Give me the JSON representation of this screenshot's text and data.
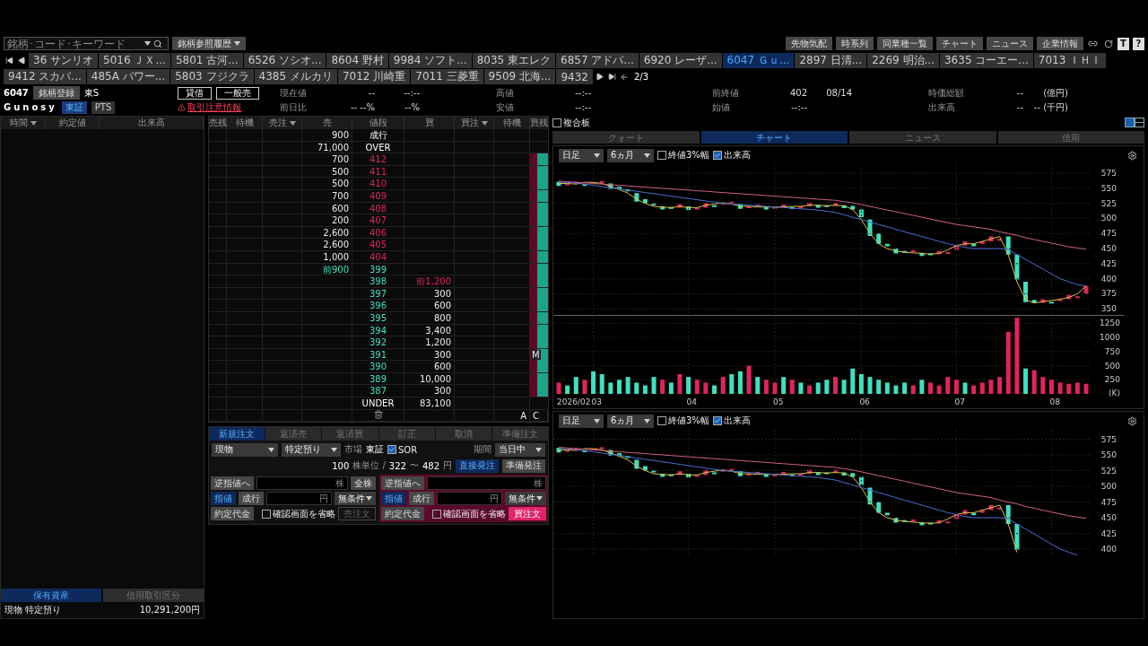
{
  "toolbar": {
    "search": {
      "placeholder": "銘柄･コード･キーワード"
    },
    "history_button": "銘柄参照履歴",
    "buttons": [
      "先物気配",
      "時系列",
      "同業種一覧",
      "チャート",
      "ニュース",
      "企業情報"
    ],
    "text_buttons": [
      "T",
      "?"
    ]
  },
  "ticker_tabs": [
    {
      "label": "36 サンリオ",
      "selected": false
    },
    {
      "label": "5016 ＪＸ...",
      "selected": false
    },
    {
      "label": "5801 古河...",
      "selected": false
    },
    {
      "label": "6526 ソシオ...",
      "selected": false
    },
    {
      "label": "8604 野村",
      "selected": false
    },
    {
      "label": "9984 ソフト...",
      "selected": false
    },
    {
      "label": "8035 東エレク",
      "selected": false
    },
    {
      "label": "6857 アドバ...",
      "selected": false
    },
    {
      "label": "6920 レーザ...",
      "selected": false
    },
    {
      "label": "6047 Ｇｕ...",
      "selected": true
    },
    {
      "label": "2897 日清...",
      "selected": false
    },
    {
      "label": "2269 明治...",
      "selected": false
    },
    {
      "label": "3635 コーエー...",
      "selected": false
    },
    {
      "label": "7013 ＩＨＩ",
      "selected": false
    },
    {
      "label": "9412 スカパ...",
      "selected": false
    },
    {
      "label": "485A パワー...",
      "selected": false
    },
    {
      "label": "5803 フジクラ",
      "selected": false
    },
    {
      "label": "4385 メルカリ",
      "selected": false
    },
    {
      "label": "7012 川崎重",
      "selected": false
    },
    {
      "label": "7011 三菱重",
      "selected": false
    },
    {
      "label": "9509 北海...",
      "selected": false
    },
    {
      "label": "9432",
      "selected": false
    }
  ],
  "pager": "2/3",
  "stock": {
    "code": "6047",
    "register_button": "銘柄登録",
    "market_short": "東S",
    "name": "Gunosy",
    "venues": [
      {
        "label": "東証",
        "selected": true
      },
      {
        "label": "PTS",
        "selected": false
      }
    ],
    "badges": [
      "貸借",
      "一般売"
    ],
    "warning": "取引注意情報",
    "quotes": [
      {
        "label": "現在値",
        "values": [
          "--",
          "--:--"
        ]
      },
      {
        "label": "高値",
        "values": [
          "--:--"
        ]
      },
      {
        "label": "前終値",
        "values": [
          "402",
          "08/14"
        ]
      },
      {
        "label": "時価総額",
        "values": [
          "--",
          "(億円)"
        ]
      },
      {
        "label": "前日比",
        "values": [
          "-- --%",
          "--%"
        ]
      },
      {
        "label": "安値",
        "values": [
          "--:--"
        ]
      },
      {
        "label": "始値",
        "values": [
          "--:--"
        ]
      },
      {
        "label": "出来高",
        "values": [
          "--",
          "-- (千円)"
        ]
      }
    ]
  },
  "executions_panel": {
    "columns": [
      "時間",
      "約定値",
      "出来高"
    ],
    "tabs": [
      {
        "label": "保有資産",
        "selected": true
      },
      {
        "label": "信用取引区分",
        "selected": false
      }
    ],
    "holdings": [
      {
        "label": "現物 特定預り",
        "value": "10,291,200円"
      }
    ]
  },
  "order_book": {
    "columns": [
      {
        "label": "売残",
        "menu": false
      },
      {
        "label": "待機",
        "menu": false
      },
      {
        "label": "売注",
        "menu": true
      },
      {
        "label": "売",
        "menu": false
      },
      {
        "label": "値段",
        "menu": false
      },
      {
        "label": "買",
        "menu": false
      },
      {
        "label": "買注",
        "menu": true
      },
      {
        "label": "待機",
        "menu": false
      },
      {
        "label": "買残",
        "menu": false
      }
    ],
    "rows": [
      {
        "sell": "900",
        "price": "成行",
        "buy": "",
        "kind": "plain",
        "previous": false
      },
      {
        "sell": "71,000",
        "price": "OVER",
        "buy": "",
        "kind": "plain",
        "previous": false
      },
      {
        "sell": "700",
        "price": "412",
        "buy": "",
        "kind": "ask",
        "previous": false
      },
      {
        "sell": "500",
        "price": "411",
        "buy": "",
        "kind": "ask",
        "previous": false
      },
      {
        "sell": "500",
        "price": "410",
        "buy": "",
        "kind": "ask",
        "previous": false
      },
      {
        "sell": "700",
        "price": "409",
        "buy": "",
        "kind": "ask",
        "previous": false
      },
      {
        "sell": "600",
        "price": "408",
        "buy": "",
        "kind": "ask",
        "previous": false
      },
      {
        "sell": "200",
        "price": "407",
        "buy": "",
        "kind": "ask",
        "previous": false
      },
      {
        "sell": "2,600",
        "price": "406",
        "buy": "",
        "kind": "ask",
        "previous": false
      },
      {
        "sell": "2,600",
        "price": "405",
        "buy": "",
        "kind": "ask",
        "previous": false
      },
      {
        "sell": "1,000",
        "price": "404",
        "buy": "",
        "kind": "ask",
        "previous": false
      },
      {
        "sell": "前900",
        "price": "399",
        "buy": "",
        "kind": "bid",
        "previous": true
      },
      {
        "sell": "",
        "price": "398",
        "buy": "前1,200",
        "kind": "bid",
        "previous": true
      },
      {
        "sell": "",
        "price": "397",
        "buy": "300",
        "kind": "bid",
        "previous": false
      },
      {
        "sell": "",
        "price": "396",
        "buy": "600",
        "kind": "bid",
        "previous": false
      },
      {
        "sell": "",
        "price": "395",
        "buy": "800",
        "kind": "bid",
        "previous": false
      },
      {
        "sell": "",
        "price": "394",
        "buy": "3,400",
        "kind": "bid",
        "previous": false
      },
      {
        "sell": "",
        "price": "392",
        "buy": "1,200",
        "kind": "bid",
        "previous": false
      },
      {
        "sell": "",
        "price": "391",
        "buy": "300",
        "kind": "bid",
        "previous": false,
        "marker": "M"
      },
      {
        "sell": "",
        "price": "390",
        "buy": "600",
        "kind": "bid",
        "previous": false
      },
      {
        "sell": "",
        "price": "389",
        "buy": "10,000",
        "kind": "bid",
        "previous": false
      },
      {
        "sell": "",
        "price": "387",
        "buy": "300",
        "kind": "bid",
        "previous": false
      },
      {
        "sell": "",
        "price": "UNDER",
        "buy": "83,100",
        "kind": "plain",
        "previous": false
      }
    ],
    "footer": [
      "A",
      "C"
    ]
  },
  "order_entry": {
    "tabs": [
      {
        "label": "新規注文",
        "selected": true
      },
      {
        "label": "返済売",
        "selected": false
      },
      {
        "label": "返済買",
        "selected": false
      },
      {
        "label": "訂正",
        "selected": false
      },
      {
        "label": "取消",
        "selected": false
      },
      {
        "label": "準備注文",
        "selected": false
      }
    ],
    "account": "現物",
    "custody": "特定預り",
    "market_label": "市場",
    "market": "東証",
    "sor": {
      "label": "SOR",
      "checked": true
    },
    "term_label": "期間",
    "term": "当日中",
    "unit": "100",
    "unit_label": "株単位 /",
    "price_low": "322",
    "range_sep": "〜",
    "price_high": "482",
    "currency": "円",
    "send_modes": [
      {
        "label": "直接発注",
        "selected": true
      },
      {
        "label": "準備発注",
        "selected": false
      }
    ],
    "sides": [
      {
        "kind": "sell",
        "stop_button": "逆指値へ",
        "qty_unit": "株",
        "all_button": "全株",
        "price_types": [
          {
            "label": "指値",
            "selected": true
          },
          {
            "label": "成行",
            "selected": false
          }
        ],
        "price_unit": "円",
        "condition": "無条件",
        "amount_button": "約定代金",
        "skip_confirm": {
          "label": "確認画面を省略",
          "checked": false
        },
        "submit": {
          "label": "売注文",
          "disabled": true
        }
      },
      {
        "kind": "buy",
        "stop_button": "逆指値へ",
        "qty_unit": "株",
        "price_types": [
          {
            "label": "指値",
            "selected": true
          },
          {
            "label": "成行",
            "selected": false
          }
        ],
        "price_unit": "円",
        "condition": "無条件",
        "amount_button": "約定代金",
        "skip_confirm": {
          "label": "確認画面を省略",
          "checked": false
        },
        "submit": {
          "label": "買注文",
          "disabled": false
        }
      }
    ]
  },
  "chart_panel": {
    "composite": {
      "label": "複合板",
      "checked": false
    },
    "tabs": [
      {
        "label": "クォート",
        "selected": false
      },
      {
        "label": "チャート",
        "selected": true
      },
      {
        "label": "ニュース",
        "selected": false
      },
      {
        "label": "信用",
        "selected": false
      }
    ],
    "charts": [
      {
        "period": "日足",
        "range": "6ヵ月",
        "options": [
          {
            "label": "終値3%幅",
            "checked": false
          },
          {
            "label": "出来高",
            "checked": true
          }
        ],
        "chart_data": {
          "type": "line",
          "grid": true,
          "ylim": [
            340,
            590
          ],
          "yticks": [
            350,
            375,
            400,
            425,
            450,
            475,
            500,
            525,
            550,
            575
          ],
          "series": [
            {
              "color": "#d8c040",
              "values": [
                558,
                558,
                557,
                560,
                560,
                558,
                553,
                548,
                542,
                532,
                525,
                520,
                519,
                518,
                520,
                518,
                518,
                522,
                524,
                526,
                524,
                520,
                520,
                519,
                519,
                519,
                519,
                520,
                520,
                522,
                522,
                521,
                522,
                521,
                515,
                498,
                475,
                458,
                450,
                446,
                444,
                443,
                442,
                441,
                442,
                448,
                455,
                458,
                458,
                462,
                466,
                470,
                440,
                395,
                365,
                360,
                362,
                364,
                366,
                369,
                375,
                388
              ]
            },
            {
              "color": "#4a6fd0",
              "values": [
                560,
                560,
                558,
                557,
                555,
                553,
                551,
                549,
                547,
                545,
                543,
                541,
                539,
                537,
                535,
                533,
                531,
                529,
                527,
                525,
                524,
                523,
                522,
                521,
                520,
                519,
                518,
                517,
                516,
                515,
                514,
                512,
                510,
                506,
                502,
                498,
                494,
                490,
                486,
                482,
                478,
                474,
                470,
                466,
                462,
                458,
                455,
                452,
                450,
                450,
                450,
                450,
                448,
                440,
                432,
                424,
                416,
                408,
                400,
                395,
                390,
                388
              ]
            },
            {
              "color": "#d06080",
              "values": [
                562,
                561,
                560,
                559,
                558,
                557,
                556,
                555,
                554,
                553,
                552,
                551,
                550,
                549,
                548,
                547,
                546,
                545,
                544,
                543,
                542,
                541,
                540,
                539,
                538,
                537,
                536,
                535,
                534,
                533,
                532,
                531,
                530,
                528,
                526,
                523,
                520,
                517,
                514,
                511,
                508,
                505,
                502,
                499,
                496,
                493,
                490,
                488,
                486,
                484,
                482,
                478,
                475,
                472,
                468,
                465,
                462,
                459,
                456,
                453,
                451,
                449
              ]
            }
          ]
        },
        "volume": {
          "month_labels": [
            "2026/02",
            "03",
            "04",
            "05",
            "06",
            "07",
            "08"
          ],
          "chart_data": {
            "type": "bar",
            "grid": true,
            "ylabel": "(K)",
            "ylim": [
              0,
              1400
            ],
            "yticks": [
              250,
              500,
              750,
              1000,
              1250
            ],
            "series": [
              {
                "color": "#e0245e",
                "values": [
                  200,
                  null,
                  null,
                  250,
                  null,
                  null,
                  null,
                  null,
                  null,
                  null,
                  null,
                  null,
                  250,
                  null,
                  350,
                  null,
                  250,
                  200,
                  null,
                  300,
                  null,
                  null,
                  500,
                  null,
                  250,
                  200,
                  null,
                  250,
                  null,
                  150,
                  null,
                  null,
                  300,
                  null,
                  null,
                  null,
                  null,
                  null,
                  null,
                  null,
                  null,
                  150,
                  null,
                  200,
                  150,
                  300,
                  250,
                  null,
                  150,
                  200,
                  250,
                  300,
                  1100,
                  1350,
                  null,
                  420,
                  300,
                  250,
                  200,
                  180,
                  200,
                  180
                ]
              },
              {
                "color": "#3ee0c0",
                "values": [
                  null,
                  150,
                  300,
                  null,
                  400,
                  350,
                  200,
                  250,
                  300,
                  200,
                  150,
                  300,
                  null,
                  200,
                  null,
                  300,
                  null,
                  null,
                  150,
                  null,
                  350,
                  400,
                  null,
                  300,
                  null,
                  null,
                  300,
                  null,
                  200,
                  null,
                  200,
                  250,
                  null,
                  250,
                  450,
                  350,
                  300,
                  250,
                  200,
                  150,
                  200,
                  null,
                  250,
                  null,
                  null,
                  null,
                  null,
                  200,
                  null,
                  null,
                  null,
                  null,
                  null,
                  null,
                  450,
                  null,
                  null,
                  null,
                  null,
                  null,
                  null,
                  null
                ]
              }
            ]
          }
        }
      },
      {
        "period": "日足",
        "range": "6ヵ月",
        "options": [
          {
            "label": "終値3%幅",
            "checked": false
          },
          {
            "label": "出来高",
            "checked": true
          }
        ],
        "chart_data": {
          "type": "line",
          "grid": true,
          "ylim": [
            390,
            590
          ],
          "yticks": [
            400,
            425,
            450,
            475,
            500,
            525,
            550,
            575
          ],
          "series": [
            {
              "color": "#d8c040",
              "values": [
                558,
                558,
                557,
                560,
                560,
                558,
                553,
                548,
                542,
                532,
                525,
                520,
                519,
                518,
                520,
                518,
                518,
                522,
                524,
                526,
                524,
                520,
                520,
                519,
                519,
                519,
                519,
                520,
                520,
                522,
                522,
                521,
                522,
                521,
                515,
                498,
                475,
                458,
                450,
                446,
                444,
                443,
                442,
                441,
                442,
                448,
                455,
                458,
                458,
                462,
                466,
                470,
                440,
                395,
                null,
                null,
                null,
                null,
                null,
                null,
                null,
                null
              ]
            },
            {
              "color": "#4a6fd0",
              "values": [
                560,
                560,
                558,
                557,
                555,
                553,
                551,
                549,
                547,
                545,
                543,
                541,
                539,
                537,
                535,
                533,
                531,
                529,
                527,
                525,
                524,
                523,
                522,
                521,
                520,
                519,
                518,
                517,
                516,
                515,
                514,
                512,
                510,
                506,
                502,
                498,
                494,
                490,
                486,
                482,
                478,
                474,
                470,
                466,
                462,
                458,
                455,
                452,
                450,
                450,
                450,
                450,
                448,
                440,
                432,
                424,
                416,
                408,
                400,
                395,
                390,
                null
              ]
            },
            {
              "color": "#d06080",
              "values": [
                562,
                561,
                560,
                559,
                558,
                557,
                556,
                555,
                554,
                553,
                552,
                551,
                550,
                549,
                548,
                547,
                546,
                545,
                544,
                543,
                542,
                541,
                540,
                539,
                538,
                537,
                536,
                535,
                534,
                533,
                532,
                531,
                530,
                528,
                526,
                523,
                520,
                517,
                514,
                511,
                508,
                505,
                502,
                499,
                496,
                493,
                490,
                488,
                486,
                484,
                482,
                478,
                475,
                472,
                468,
                465,
                462,
                459,
                456,
                453,
                451,
                449
              ]
            }
          ]
        }
      }
    ]
  }
}
